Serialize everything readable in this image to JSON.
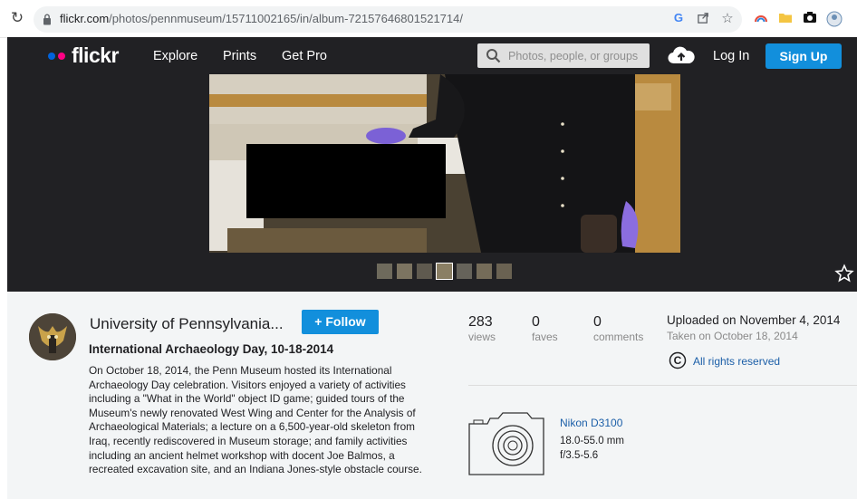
{
  "browser": {
    "url_host": "flickr.com",
    "url_path": "/photos/pennmuseum/15711002165/in/album-72157646801521714/"
  },
  "nav": {
    "logo": "flickr",
    "links": [
      "Explore",
      "Prints",
      "Get Pro"
    ],
    "search_placeholder": "Photos, people, or groups",
    "login": "Log In",
    "signup": "Sign Up"
  },
  "owner": {
    "name": "University of Pennsylvania...",
    "follow_label": "Follow"
  },
  "photo": {
    "title": "International Archaeology Day, 10-18-2014",
    "description": "On October 18, 2014, the Penn Museum hosted its International Archaeology Day celebration. Visitors enjoyed a variety of activities including a \"What in the World\" object ID game; guided tours of the Museum's newly renovated West Wing and Center for the Analysis of Archaeological Materials; a lecture on a 6,500-year-old skeleton from Iraq, recently rediscovered in Museum storage; and family activities including an ancient helmet workshop with docent Joe Balmos, a recreated excavation site, and an Indiana Jones-style obstacle course."
  },
  "stats": {
    "views": {
      "value": "283",
      "label": "views"
    },
    "faves": {
      "value": "0",
      "label": "faves"
    },
    "comments": {
      "value": "0",
      "label": "comments"
    }
  },
  "dates": {
    "uploaded": "Uploaded on November 4, 2014",
    "taken": "Taken on October 18, 2014"
  },
  "license": "All rights reserved",
  "camera": {
    "model": "Nikon D3100",
    "lens": "18.0-55.0 mm",
    "aperture": "f/3.5-5.6"
  },
  "colors": {
    "brand_blue": "#128fdc",
    "nav_bg": "#212124",
    "logo_blue": "#0063dc",
    "logo_pink": "#ff0084",
    "link_blue": "#1c5fa8"
  }
}
